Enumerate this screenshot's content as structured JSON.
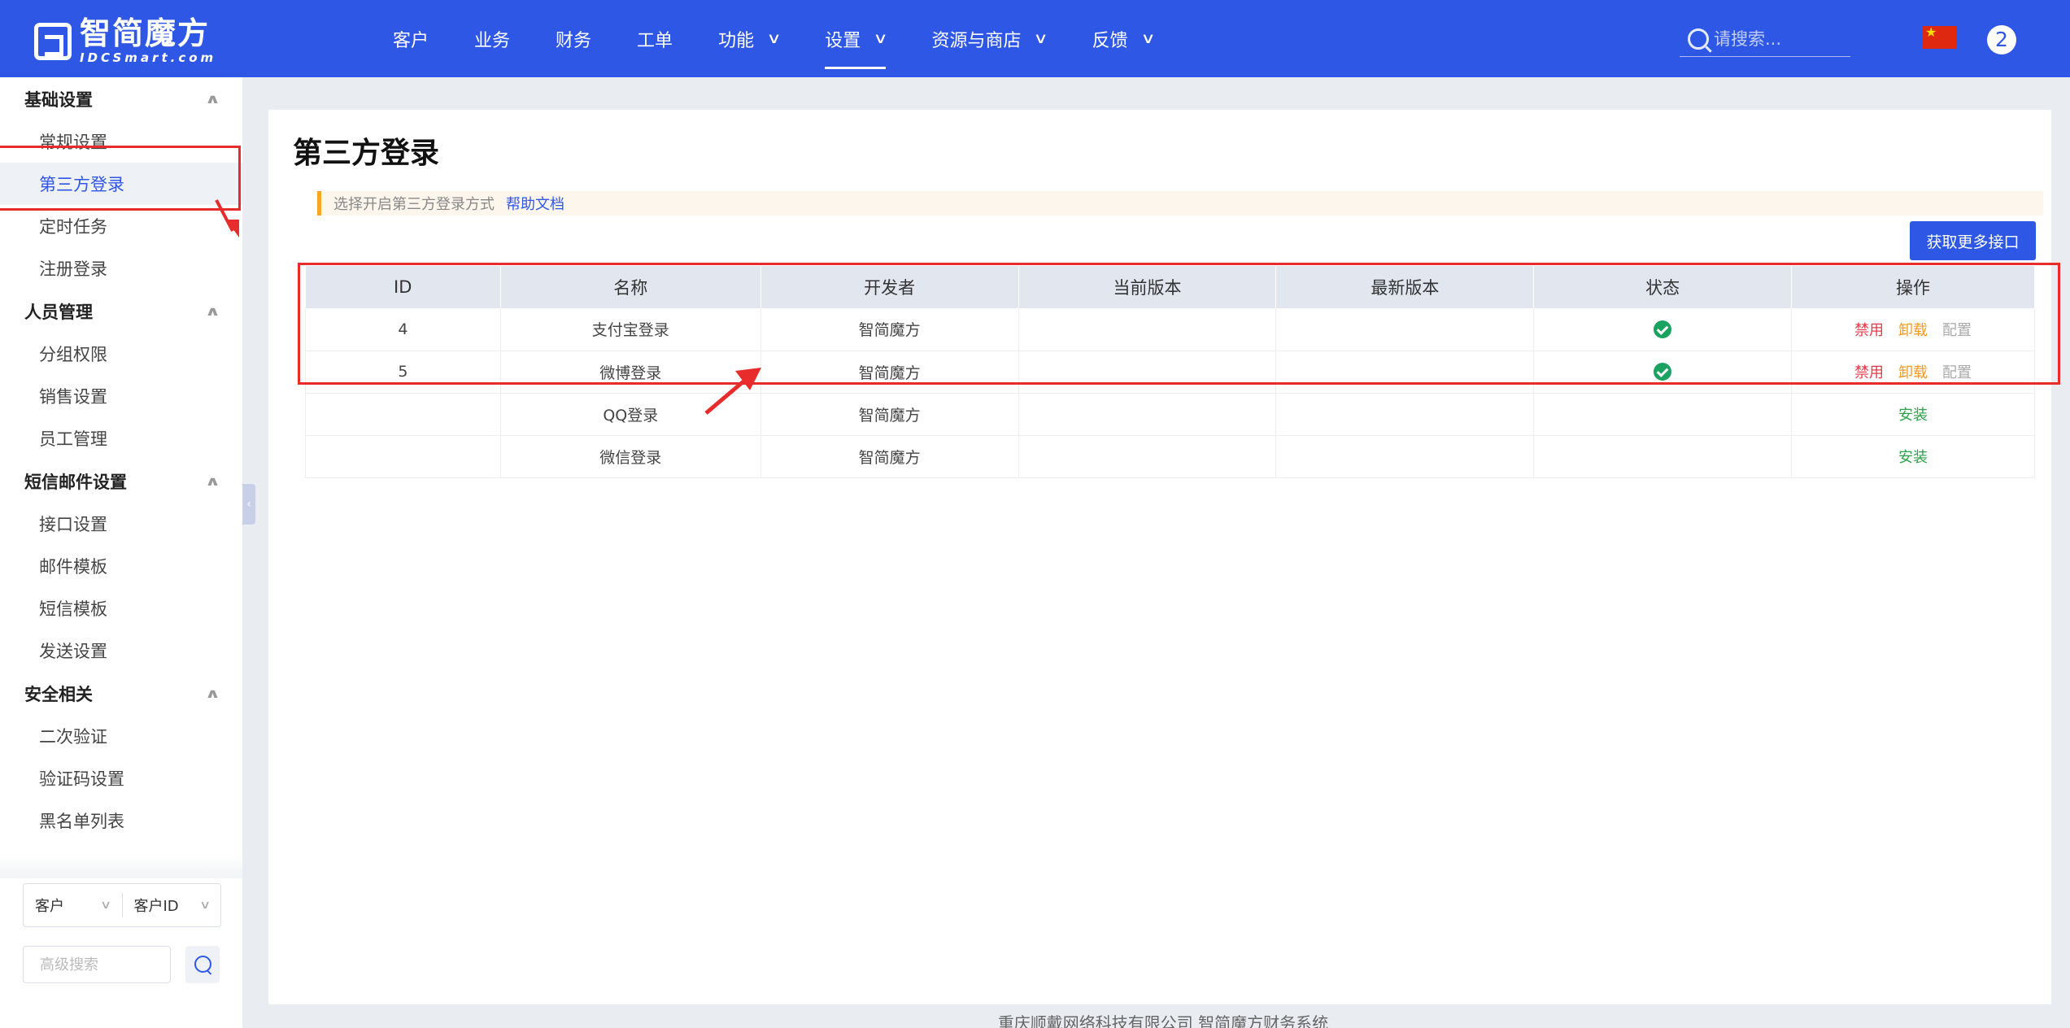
{
  "brand": {
    "cn": "智简魔方",
    "en": "IDCSmart.com"
  },
  "nav": [
    {
      "label": "客户",
      "dropdown": false
    },
    {
      "label": "业务",
      "dropdown": false
    },
    {
      "label": "财务",
      "dropdown": false
    },
    {
      "label": "工单",
      "dropdown": false
    },
    {
      "label": "功能",
      "dropdown": true
    },
    {
      "label": "设置",
      "dropdown": true,
      "active": true
    },
    {
      "label": "资源与商店",
      "dropdown": true
    },
    {
      "label": "反馈",
      "dropdown": true
    }
  ],
  "search": {
    "placeholder": "请搜索..."
  },
  "user": {
    "badge": "2"
  },
  "sidebar": {
    "groups": [
      {
        "title": "基础设置",
        "items": [
          "常规设置",
          "第三方登录",
          "定时任务",
          "注册登录"
        ]
      },
      {
        "title": "人员管理",
        "items": [
          "分组权限",
          "销售设置",
          "员工管理"
        ]
      },
      {
        "title": "短信邮件设置",
        "items": [
          "接口设置",
          "邮件模板",
          "短信模板",
          "发送设置"
        ]
      },
      {
        "title": "安全相关",
        "items": [
          "二次验证",
          "验证码设置",
          "黑名单列表"
        ]
      }
    ],
    "active_item": "第三方登录",
    "filter": {
      "type": "客户",
      "field": "客户ID"
    },
    "advanced_search": {
      "placeholder": "高级搜索"
    }
  },
  "main": {
    "title": "第三方登录",
    "tip": "选择开启第三方登录方式",
    "tip_link": "帮助文档",
    "more_button": "获取更多接口",
    "table": {
      "headers": [
        "ID",
        "名称",
        "开发者",
        "当前版本",
        "最新版本",
        "状态",
        "操作"
      ],
      "rows": [
        {
          "id": "4",
          "name": "支付宝登录",
          "developer": "智简魔方",
          "current_version": "",
          "latest_version": "",
          "enabled": true,
          "actions": [
            "禁用",
            "卸载",
            "配置"
          ]
        },
        {
          "id": "5",
          "name": "微博登录",
          "developer": "智简魔方",
          "current_version": "",
          "latest_version": "",
          "enabled": true,
          "actions": [
            "禁用",
            "卸载",
            "配置"
          ]
        },
        {
          "id": "",
          "name": "QQ登录",
          "developer": "智简魔方",
          "current_version": "",
          "latest_version": "",
          "enabled": false,
          "actions": [
            "安装"
          ]
        },
        {
          "id": "",
          "name": "微信登录",
          "developer": "智简魔方",
          "current_version": "",
          "latest_version": "",
          "enabled": false,
          "actions": [
            "安装"
          ]
        }
      ]
    }
  },
  "footer": "重庆顺戴网络科技有限公司 智简魔方财务系统",
  "colors": {
    "primary": "#2f57e6",
    "danger": "#e8394a",
    "warning": "#f59a23",
    "success": "#1aa260",
    "annotation": "#e82b2b"
  }
}
